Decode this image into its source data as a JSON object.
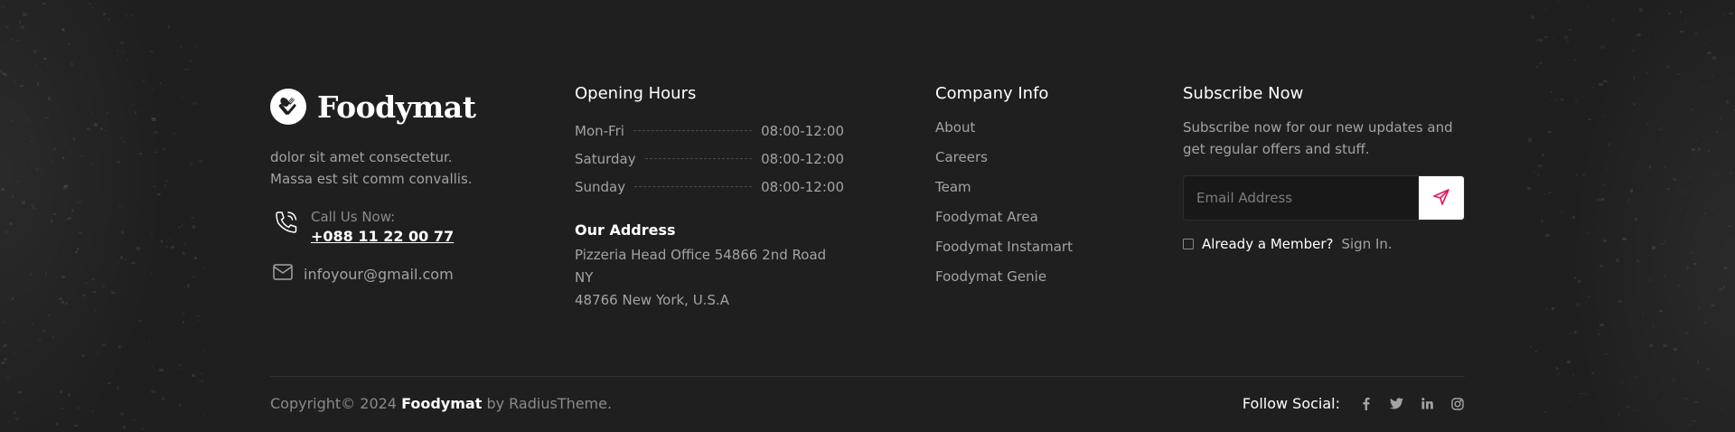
{
  "brand": {
    "name": "Foodymat",
    "logo_icon": "fork-spoon-icon"
  },
  "about": {
    "text": "dolor sit amet consectetur. Massa est sit comm convallis."
  },
  "contact": {
    "call_label": "Call Us Now:",
    "call_number": "+088 11 22 00 77",
    "email": "infoyour@gmail.com"
  },
  "hours": {
    "title": "Opening Hours",
    "rows": [
      {
        "day": "Mon-Fri",
        "time": "08:00-12:00"
      },
      {
        "day": "Saturday",
        "time": "08:00-12:00"
      },
      {
        "day": "Sunday",
        "time": "08:00-12:00"
      }
    ]
  },
  "address": {
    "title": "Our Address",
    "line1": "Pizzeria Head Office 54866 2nd Road NY",
    "line2": "48766 New York, U.S.A"
  },
  "company": {
    "title": "Company Info",
    "links": [
      "About",
      "Careers",
      "Team",
      "Foodymat Area",
      "Foodymat Instamart",
      "Foodymat Genie"
    ]
  },
  "subscribe": {
    "title": "Subscribe Now",
    "text": "Subscribe now for our new updates and get regular offers and stuff.",
    "placeholder": "Email Address",
    "member_text": "Already a Member?",
    "member_link": "Sign In."
  },
  "bottom": {
    "copyright_prefix": "Copyright© 2024",
    "copyright_brand": "Foodymat",
    "copyright_suffix": "by RadiusTheme.",
    "follow_label": "Follow Social:",
    "social_icons": [
      "facebook-icon",
      "twitter-icon",
      "linkedin-icon",
      "instagram-icon"
    ]
  },
  "colors": {
    "background": "#1f1f1f",
    "accent": "#e8175d",
    "text": "#a3a3a3",
    "heading": "#ffffff"
  }
}
